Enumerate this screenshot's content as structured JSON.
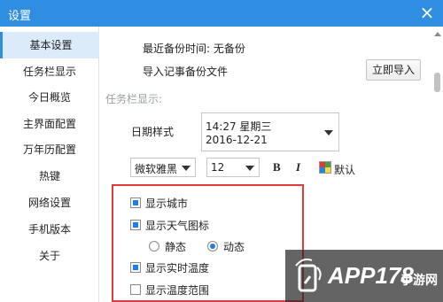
{
  "window": {
    "title": "设置",
    "close_glyph": "×"
  },
  "sidebar": {
    "items": [
      {
        "label": "基本设置",
        "active": true
      },
      {
        "label": "任务栏显示"
      },
      {
        "label": "今日概览"
      },
      {
        "label": "主界面配置"
      },
      {
        "label": "万年历配置"
      },
      {
        "label": "热键"
      },
      {
        "label": "网络设置"
      },
      {
        "label": "手机版本"
      },
      {
        "label": "关于"
      }
    ]
  },
  "backup": {
    "last_backup": "最近备份时间: 无备份",
    "import_label": "导入记事备份文件",
    "import_button": "立即导入"
  },
  "taskbar": {
    "section_title": "任务栏显示:",
    "date_style_label": "日期样式",
    "date_style_line1": "14:27  星期三",
    "date_style_line2": "2016-12-21",
    "font_family": "微软雅黑",
    "font_size": "12",
    "bold_glyph": "B",
    "italic_glyph": "I",
    "default_label": "默认",
    "options": {
      "show_city": "显示城市",
      "show_weather_icon": "显示天气图标",
      "static_label": "静态",
      "dynamic_label": "动态",
      "show_realtime_temp": "显示实时温度",
      "show_temp_range": "显示温度范围"
    },
    "state": {
      "show_city": true,
      "show_weather_icon": true,
      "weather_icon_mode": "动态",
      "show_realtime_temp": true,
      "show_temp_range": false
    }
  },
  "watermark": {
    "text": "APP178",
    "sub": "手游网"
  },
  "colors": {
    "titlebar": "#2f8ee0",
    "accent": "#1e7ee6",
    "highlight_box": "#e33b3b",
    "sidebar_active": "#dcebfa"
  }
}
